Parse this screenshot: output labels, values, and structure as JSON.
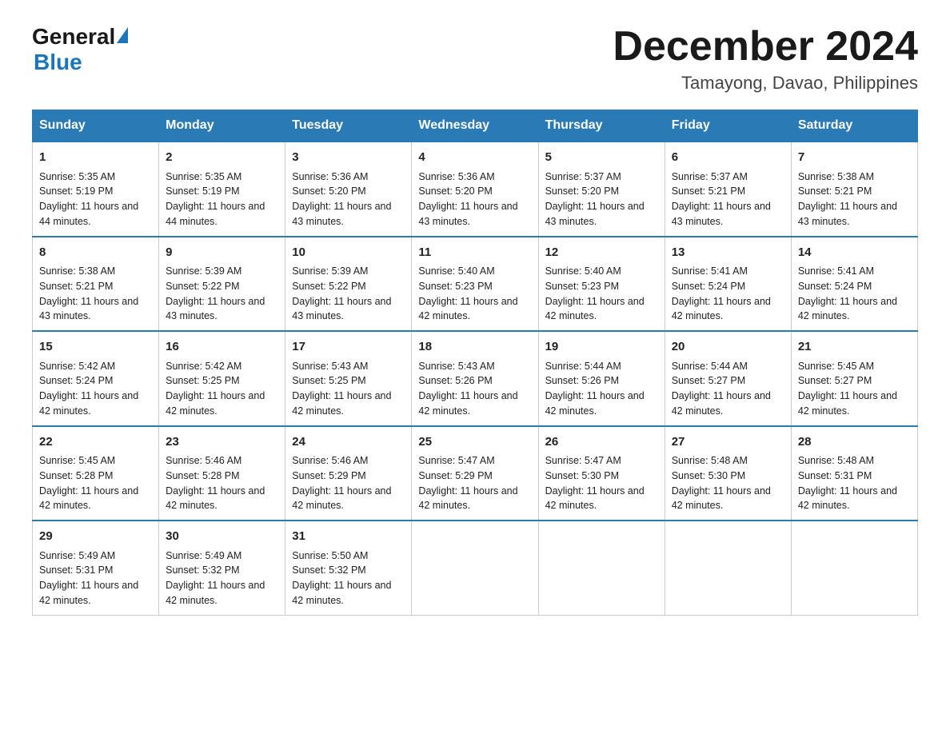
{
  "header": {
    "logo_general": "General",
    "logo_blue": "Blue",
    "month_title": "December 2024",
    "subtitle": "Tamayong, Davao, Philippines"
  },
  "days_of_week": [
    "Sunday",
    "Monday",
    "Tuesday",
    "Wednesday",
    "Thursday",
    "Friday",
    "Saturday"
  ],
  "weeks": [
    [
      {
        "day": "1",
        "sunrise": "5:35 AM",
        "sunset": "5:19 PM",
        "daylight": "11 hours and 44 minutes."
      },
      {
        "day": "2",
        "sunrise": "5:35 AM",
        "sunset": "5:19 PM",
        "daylight": "11 hours and 44 minutes."
      },
      {
        "day": "3",
        "sunrise": "5:36 AM",
        "sunset": "5:20 PM",
        "daylight": "11 hours and 43 minutes."
      },
      {
        "day": "4",
        "sunrise": "5:36 AM",
        "sunset": "5:20 PM",
        "daylight": "11 hours and 43 minutes."
      },
      {
        "day": "5",
        "sunrise": "5:37 AM",
        "sunset": "5:20 PM",
        "daylight": "11 hours and 43 minutes."
      },
      {
        "day": "6",
        "sunrise": "5:37 AM",
        "sunset": "5:21 PM",
        "daylight": "11 hours and 43 minutes."
      },
      {
        "day": "7",
        "sunrise": "5:38 AM",
        "sunset": "5:21 PM",
        "daylight": "11 hours and 43 minutes."
      }
    ],
    [
      {
        "day": "8",
        "sunrise": "5:38 AM",
        "sunset": "5:21 PM",
        "daylight": "11 hours and 43 minutes."
      },
      {
        "day": "9",
        "sunrise": "5:39 AM",
        "sunset": "5:22 PM",
        "daylight": "11 hours and 43 minutes."
      },
      {
        "day": "10",
        "sunrise": "5:39 AM",
        "sunset": "5:22 PM",
        "daylight": "11 hours and 43 minutes."
      },
      {
        "day": "11",
        "sunrise": "5:40 AM",
        "sunset": "5:23 PM",
        "daylight": "11 hours and 42 minutes."
      },
      {
        "day": "12",
        "sunrise": "5:40 AM",
        "sunset": "5:23 PM",
        "daylight": "11 hours and 42 minutes."
      },
      {
        "day": "13",
        "sunrise": "5:41 AM",
        "sunset": "5:24 PM",
        "daylight": "11 hours and 42 minutes."
      },
      {
        "day": "14",
        "sunrise": "5:41 AM",
        "sunset": "5:24 PM",
        "daylight": "11 hours and 42 minutes."
      }
    ],
    [
      {
        "day": "15",
        "sunrise": "5:42 AM",
        "sunset": "5:24 PM",
        "daylight": "11 hours and 42 minutes."
      },
      {
        "day": "16",
        "sunrise": "5:42 AM",
        "sunset": "5:25 PM",
        "daylight": "11 hours and 42 minutes."
      },
      {
        "day": "17",
        "sunrise": "5:43 AM",
        "sunset": "5:25 PM",
        "daylight": "11 hours and 42 minutes."
      },
      {
        "day": "18",
        "sunrise": "5:43 AM",
        "sunset": "5:26 PM",
        "daylight": "11 hours and 42 minutes."
      },
      {
        "day": "19",
        "sunrise": "5:44 AM",
        "sunset": "5:26 PM",
        "daylight": "11 hours and 42 minutes."
      },
      {
        "day": "20",
        "sunrise": "5:44 AM",
        "sunset": "5:27 PM",
        "daylight": "11 hours and 42 minutes."
      },
      {
        "day": "21",
        "sunrise": "5:45 AM",
        "sunset": "5:27 PM",
        "daylight": "11 hours and 42 minutes."
      }
    ],
    [
      {
        "day": "22",
        "sunrise": "5:45 AM",
        "sunset": "5:28 PM",
        "daylight": "11 hours and 42 minutes."
      },
      {
        "day": "23",
        "sunrise": "5:46 AM",
        "sunset": "5:28 PM",
        "daylight": "11 hours and 42 minutes."
      },
      {
        "day": "24",
        "sunrise": "5:46 AM",
        "sunset": "5:29 PM",
        "daylight": "11 hours and 42 minutes."
      },
      {
        "day": "25",
        "sunrise": "5:47 AM",
        "sunset": "5:29 PM",
        "daylight": "11 hours and 42 minutes."
      },
      {
        "day": "26",
        "sunrise": "5:47 AM",
        "sunset": "5:30 PM",
        "daylight": "11 hours and 42 minutes."
      },
      {
        "day": "27",
        "sunrise": "5:48 AM",
        "sunset": "5:30 PM",
        "daylight": "11 hours and 42 minutes."
      },
      {
        "day": "28",
        "sunrise": "5:48 AM",
        "sunset": "5:31 PM",
        "daylight": "11 hours and 42 minutes."
      }
    ],
    [
      {
        "day": "29",
        "sunrise": "5:49 AM",
        "sunset": "5:31 PM",
        "daylight": "11 hours and 42 minutes."
      },
      {
        "day": "30",
        "sunrise": "5:49 AM",
        "sunset": "5:32 PM",
        "daylight": "11 hours and 42 minutes."
      },
      {
        "day": "31",
        "sunrise": "5:50 AM",
        "sunset": "5:32 PM",
        "daylight": "11 hours and 42 minutes."
      },
      null,
      null,
      null,
      null
    ]
  ],
  "labels": {
    "sunrise": "Sunrise:",
    "sunset": "Sunset:",
    "daylight": "Daylight:"
  }
}
